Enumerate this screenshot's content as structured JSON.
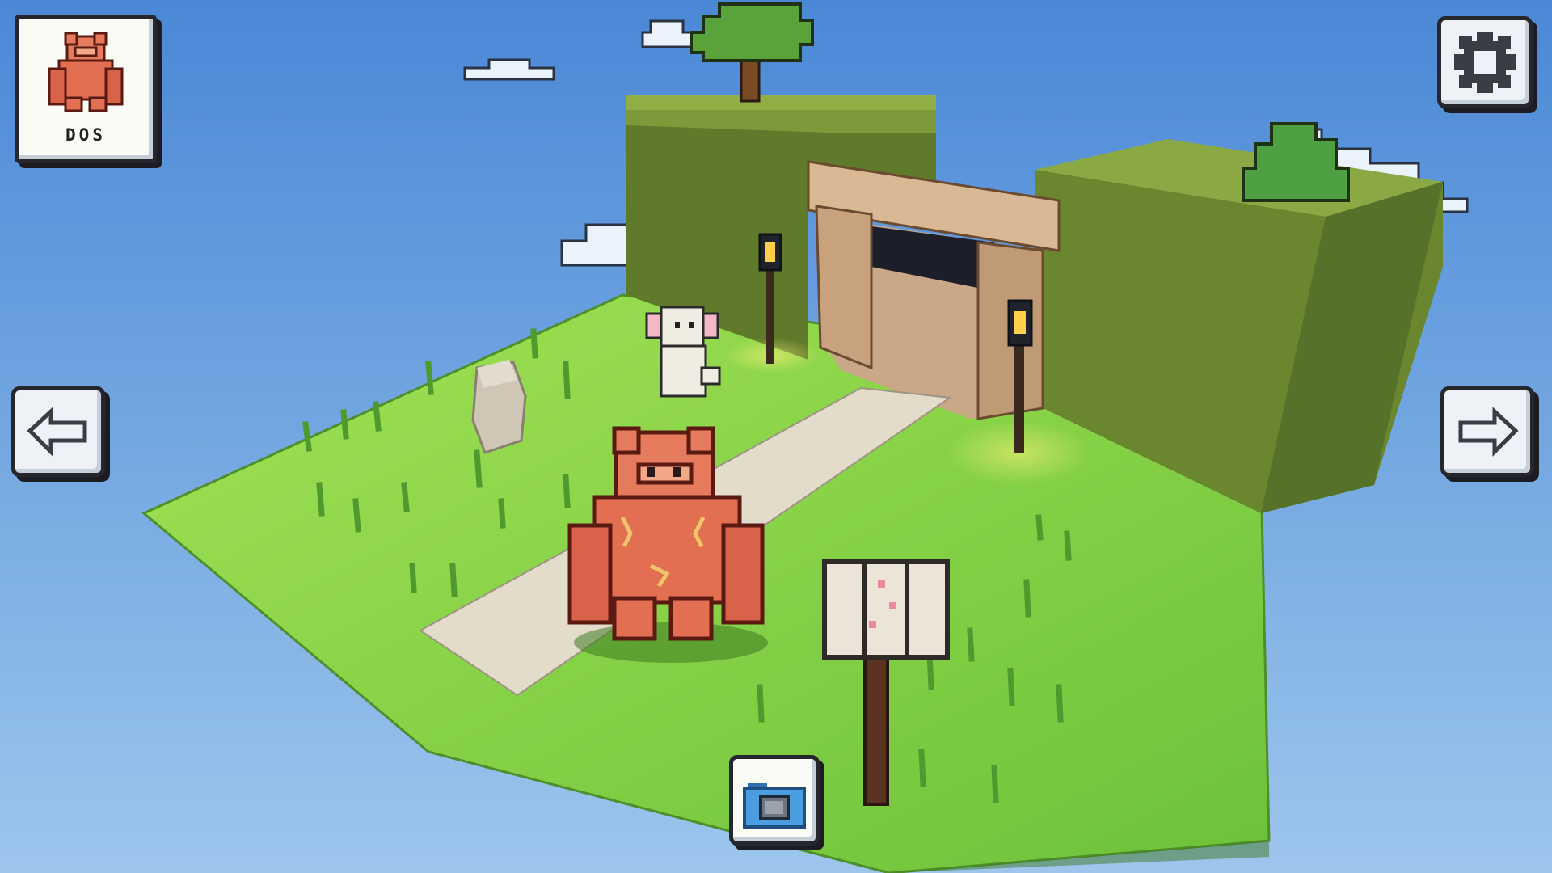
{
  "character": {
    "name": "DOS"
  },
  "colors": {
    "sky_top": "#4a88d6",
    "sky_bottom": "#9cc6ec",
    "grass": "#8ed84a",
    "hedge": "#6f8a32",
    "player": "#e8785a",
    "button_bg": "#eef2f6",
    "outline": "#26272d",
    "camera_icon": "#4a9ee0"
  },
  "icons": {
    "character_card": "muscular-creature-portrait",
    "settings": "gear-icon",
    "previous": "arrow-left-icon",
    "next": "arrow-right-icon",
    "camera": "camera-icon"
  }
}
